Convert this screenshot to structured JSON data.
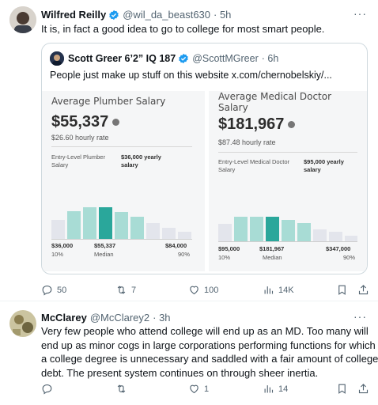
{
  "tweet1": {
    "author_name": "Wilfred Reilly",
    "author_handle": "@wil_da_beast630",
    "time": "· 5h",
    "text": "It is, in fact a good idea to go to college for most smart people.",
    "quote": {
      "author_name": "Scott Greer 6’2” IQ 187",
      "author_handle": "@ScottMGreer",
      "time": "· 6h",
      "text": "People just make up stuff on this website  x.com/chernobelskiy/...",
      "cards": [
        {
          "title_line1": "Average Plumber Salary",
          "title_line2": "",
          "amount": "$55,337",
          "hourly": "$26.60 hourly rate",
          "entry_label_1": "Entry-Level Plumber",
          "entry_label_2": "Salary",
          "entry_value_1": "$36,000 yearly",
          "entry_value_2": "salary",
          "axis_left_value": "$36,000",
          "axis_left_sub": "10%",
          "axis_mid_value": "$55,337",
          "axis_mid_sub": "Median",
          "axis_right_value": "$84,000",
          "axis_right_sub": "90%"
        },
        {
          "title_line1": "Average Medical Doctor",
          "title_line2": "Salary",
          "amount": "$181,967",
          "hourly": "$87.48 hourly rate",
          "entry_label_1": "Entry-Level Medical Doctor",
          "entry_label_2": "Salary",
          "entry_value_1": "$95,000 yearly",
          "entry_value_2": "salary",
          "axis_left_value": "$95,000",
          "axis_left_sub": "10%",
          "axis_mid_value": "$181,967",
          "axis_mid_sub": "Median",
          "axis_right_value": "$347,000",
          "axis_right_sub": "90%"
        }
      ]
    },
    "actions": {
      "replies": "50",
      "retweets": "7",
      "likes": "100",
      "views": "14K"
    }
  },
  "tweet2": {
    "author_name": "McClarey",
    "author_handle": "@McClarey2",
    "time": "· 3h",
    "text_lines": [
      "Very few people who attend college will end up as an MD.  Too many will",
      "end up as minor cogs in large corporations performing functions for which",
      "a college degree is unnecessary and saddled with a fair amount of college",
      "debt. The present system continues on through sheer inertia."
    ],
    "actions": {
      "replies": "",
      "retweets": "",
      "likes": "1",
      "views": "14"
    }
  },
  "icons": [
    "verified-badge-icon",
    "more-icon",
    "reply-icon",
    "retweet-icon",
    "like-icon",
    "views-icon",
    "bookmark-icon",
    "share-icon",
    "info-icon"
  ],
  "colors": {
    "accent": "#1d9bf0",
    "text": "#0f1419",
    "muted": "#536471",
    "bar_light": "#a8dcd5",
    "bar_dark": "#2aa79b",
    "bar_gray": "#e3e5ec"
  }
}
